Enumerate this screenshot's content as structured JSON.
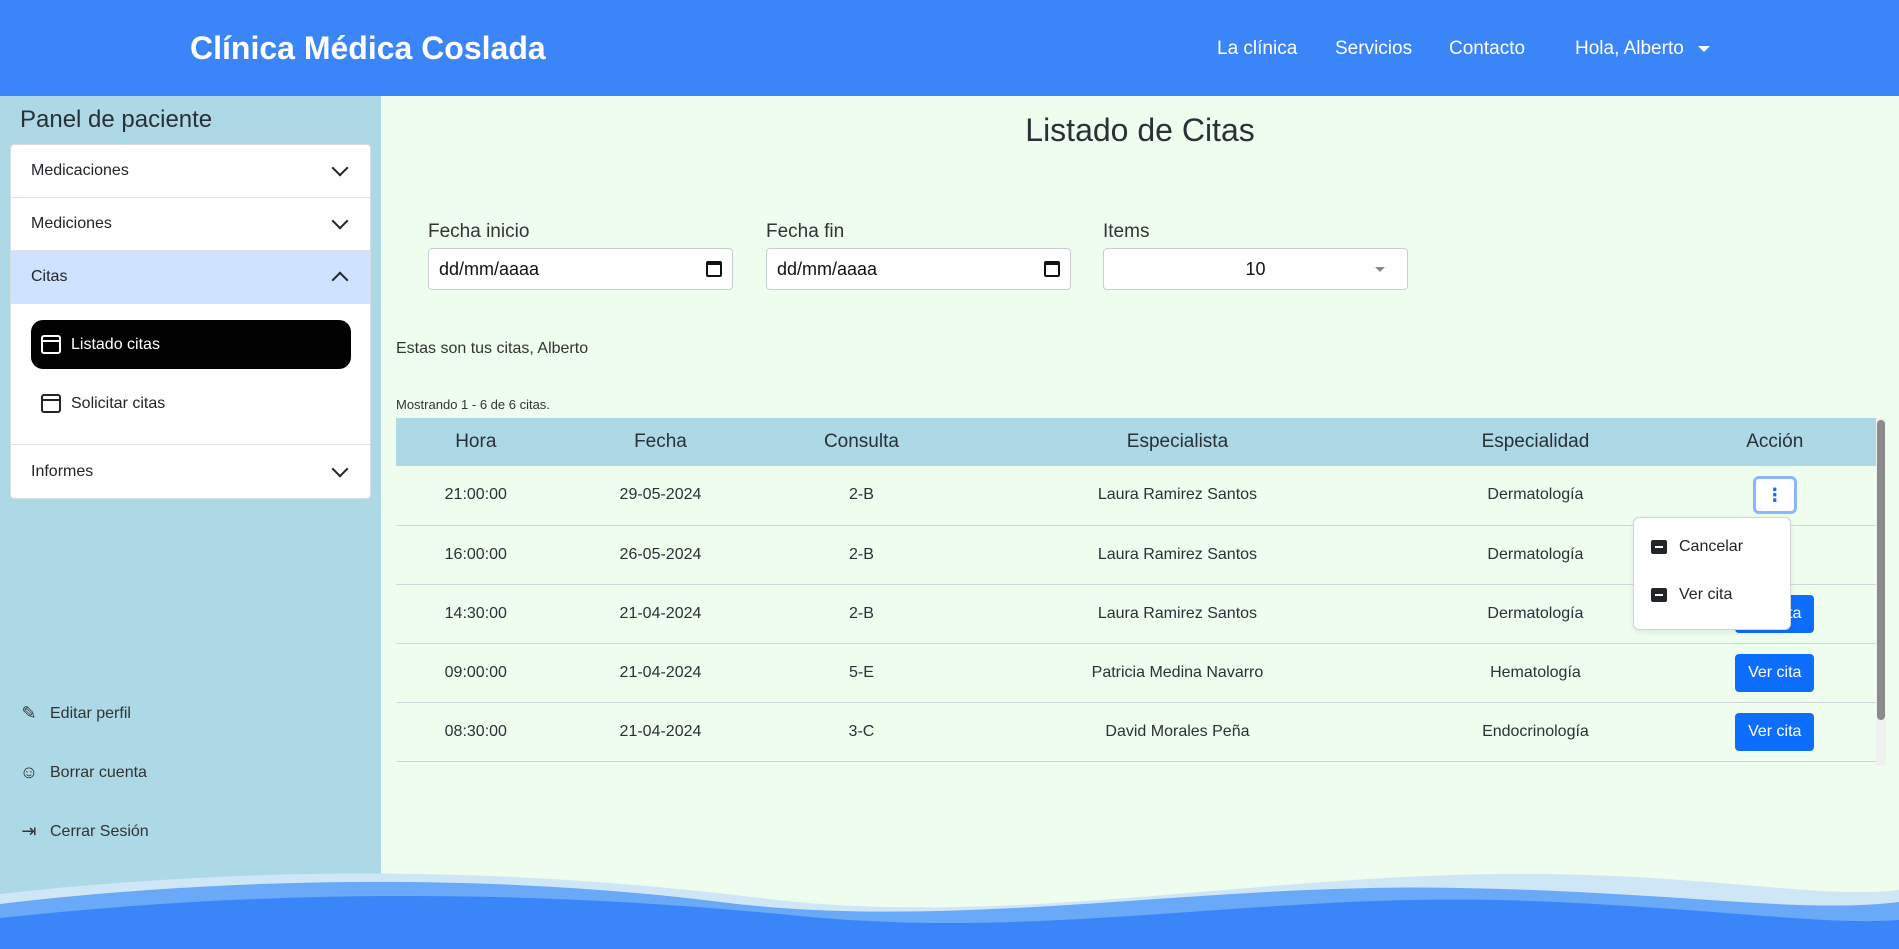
{
  "header": {
    "brand": "Clínica Médica Coslada",
    "nav": [
      "La clínica",
      "Servicios",
      "Contacto"
    ],
    "user_menu": "Hola, Alberto"
  },
  "sidebar": {
    "title": "Panel de paciente",
    "sections": [
      {
        "label": "Medicaciones"
      },
      {
        "label": "Mediciones"
      },
      {
        "label": "Citas",
        "expanded": true
      },
      {
        "label": "Informes"
      }
    ],
    "citas_links": [
      {
        "label": "Listado citas",
        "icon": "calendar-icon"
      },
      {
        "label": "Solicitar citas",
        "icon": "calendar-icon"
      }
    ],
    "actions": [
      {
        "label": "Editar perfil",
        "icon": "pencil-icon"
      },
      {
        "label": "Borrar cuenta",
        "icon": "user-remove-icon"
      },
      {
        "label": "Cerrar Sesión",
        "icon": "logout-icon"
      }
    ]
  },
  "main": {
    "title": "Listado de Citas",
    "filters": {
      "start_label": "Fecha inicio",
      "start_value": "dd/mm/aaaa",
      "end_label": "Fecha fin",
      "end_value": "dd/mm/aaaa",
      "items_label": "Items",
      "items_value": "10"
    },
    "greeting": "Estas son tus citas, Alberto",
    "showing": "Mostrando 1 - 6 de 6 citas.",
    "table": {
      "columns": [
        "Hora",
        "Fecha",
        "Consulta",
        "Especialista",
        "Especialidad",
        "Acción"
      ],
      "rows": [
        [
          "21:00:00",
          "29-05-2024",
          "2-B",
          "Laura Ramirez Santos",
          "Dermatología"
        ],
        [
          "16:00:00",
          "26-05-2024",
          "2-B",
          "Laura Ramirez Santos",
          "Dermatología"
        ],
        [
          "14:30:00",
          "21-04-2024",
          "2-B",
          "Laura Ramirez Santos",
          "Dermatología"
        ],
        [
          "09:00:00",
          "21-04-2024",
          "5-E",
          "Patricia Medina Navarro",
          "Hematología"
        ],
        [
          "08:30:00",
          "21-04-2024",
          "3-C",
          "David Morales Peña",
          "Endocrinología"
        ]
      ],
      "action_label": "Ver cita"
    },
    "dropdown": {
      "items": [
        "Cancelar",
        "Ver cita"
      ]
    }
  },
  "colors": {
    "header": "#3a86f8",
    "sidebar": "#add8e6",
    "main_bg": "#eefdee",
    "primary": "#0d6efd"
  }
}
